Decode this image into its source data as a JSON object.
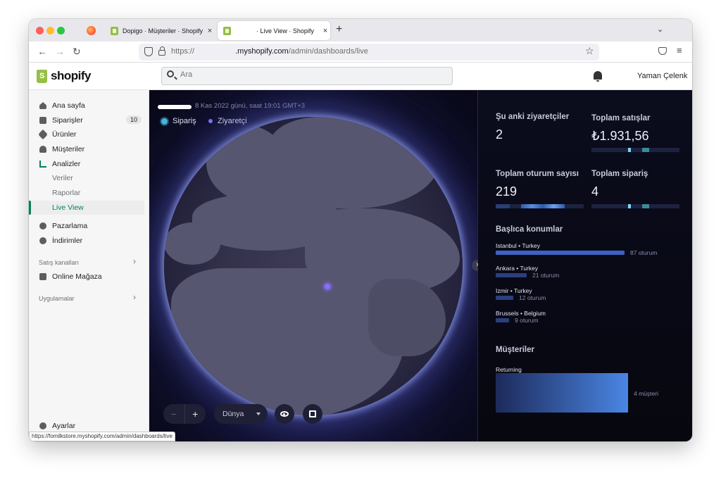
{
  "browser": {
    "tabs": [
      {
        "label": "Dopigo · Müşteriler · Shopify",
        "active": false
      },
      {
        "label": " · Live View · Shopify",
        "active": true
      }
    ],
    "url_prefix": "https://",
    "url_domain": ".myshopify.com",
    "url_path": "/admin/dashboards/live",
    "status_url": "https://fomilkstore.myshopify.com/admin/dashboards/live"
  },
  "topbar": {
    "logo_text": "shopify",
    "search_placeholder": "Ara",
    "user_name": "Yaman Çelenk"
  },
  "sidebar": {
    "items": [
      {
        "label": "Ana sayfa",
        "icon": "home-icon"
      },
      {
        "label": "Siparişler",
        "icon": "orders-icon",
        "badge": "10"
      },
      {
        "label": "Ürünler",
        "icon": "tag-icon"
      },
      {
        "label": "Müşteriler",
        "icon": "person-icon"
      },
      {
        "label": "Analizler",
        "icon": "chart-icon"
      }
    ],
    "analytics_sub": [
      {
        "label": "Veriler"
      },
      {
        "label": "Raporlar"
      },
      {
        "label": "Live View",
        "active": true
      }
    ],
    "items2": [
      {
        "label": "Pazarlama",
        "icon": "marketing-icon"
      },
      {
        "label": "İndirimler",
        "icon": "discount-icon"
      }
    ],
    "sales_channels_label": "Satış kanalları",
    "online_store_label": "Online Mağaza",
    "apps_label": "Uygulamalar",
    "settings_label": "Ayarlar"
  },
  "live": {
    "date_text": "8 Kas 2022 günü, saat 19:01 GMT+3",
    "legend_order": "Sipariş",
    "legend_visitor": "Ziyaretçi",
    "view_select": "Dünya",
    "zoom_minus": "−",
    "zoom_plus": "+"
  },
  "stats": {
    "current_visitors_label": "Şu anki ziyaretçiler",
    "current_visitors": "2",
    "total_sales_label": "Toplam satışlar",
    "total_sales": "₺1.931,56",
    "total_sessions_label": "Toplam oturum sayısı",
    "total_sessions": "219",
    "total_orders_label": "Toplam sipariş",
    "total_orders": "4"
  },
  "locations": {
    "heading": "Başlıca konumlar",
    "items": [
      {
        "name": "Istanbul • Turkey",
        "value": 87,
        "label": "87 oturum"
      },
      {
        "name": "Ankara • Turkey",
        "value": 21,
        "label": "21 oturum"
      },
      {
        "name": "Izmir • Turkey",
        "value": 12,
        "label": "12 oturum"
      },
      {
        "name": "Brussels • Belgium",
        "value": 9,
        "label": "9 oturum"
      }
    ]
  },
  "customers": {
    "heading": "Müşteriler",
    "returning_label": "Returning",
    "returning_value": "4 müşteri"
  },
  "colors": {
    "accent_green": "#008060",
    "bar_blue": "#3c63c4",
    "order_dot": "#47b8d8",
    "visitor_dot": "#7a7dff"
  }
}
